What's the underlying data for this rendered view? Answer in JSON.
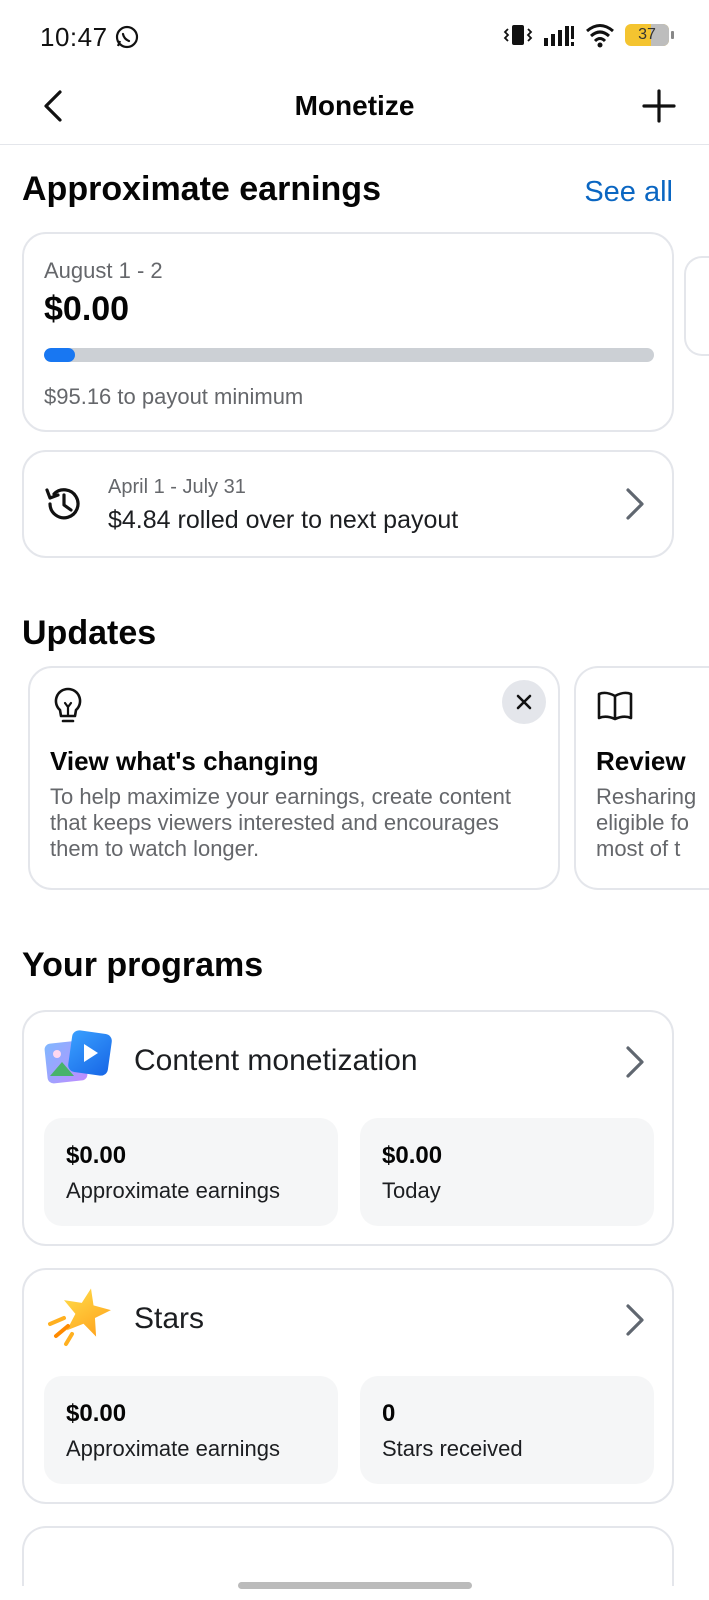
{
  "status_bar": {
    "time": "10:47",
    "battery": "37"
  },
  "header": {
    "title": "Monetize"
  },
  "earnings": {
    "title": "Approximate earnings",
    "see_all": "See all",
    "current": {
      "period": "August 1 - 2",
      "amount": "$0.00",
      "progress_fraction": 0.05,
      "note": "$95.16 to payout minimum"
    },
    "rollover": {
      "period": "April 1 - July 31",
      "text": "$4.84 rolled over to next payout"
    }
  },
  "updates": {
    "title": "Updates",
    "cards": [
      {
        "icon": "lightbulb-icon",
        "title": "View what's changing",
        "body": "To help maximize your earnings, create content that keeps viewers interested and encourages them to watch longer."
      },
      {
        "icon": "book-icon",
        "title": "Review",
        "body_lines": [
          "Resharing",
          "eligible fo",
          "most of t"
        ]
      }
    ]
  },
  "programs": {
    "title": "Your programs",
    "items": [
      {
        "name": "Content monetization",
        "icon": "video-photo-icon",
        "stats": [
          {
            "value": "$0.00",
            "label": "Approximate earnings"
          },
          {
            "value": "$0.00",
            "label": "Today"
          }
        ]
      },
      {
        "name": "Stars",
        "icon": "star-icon",
        "stats": [
          {
            "value": "$0.00",
            "label": "Approximate earnings"
          },
          {
            "value": "0",
            "label": "Stars received"
          }
        ]
      }
    ]
  },
  "colors": {
    "accent": "#1877f2",
    "link": "#0a66c2",
    "muted": "#65676b",
    "battery": "#f4c430"
  }
}
